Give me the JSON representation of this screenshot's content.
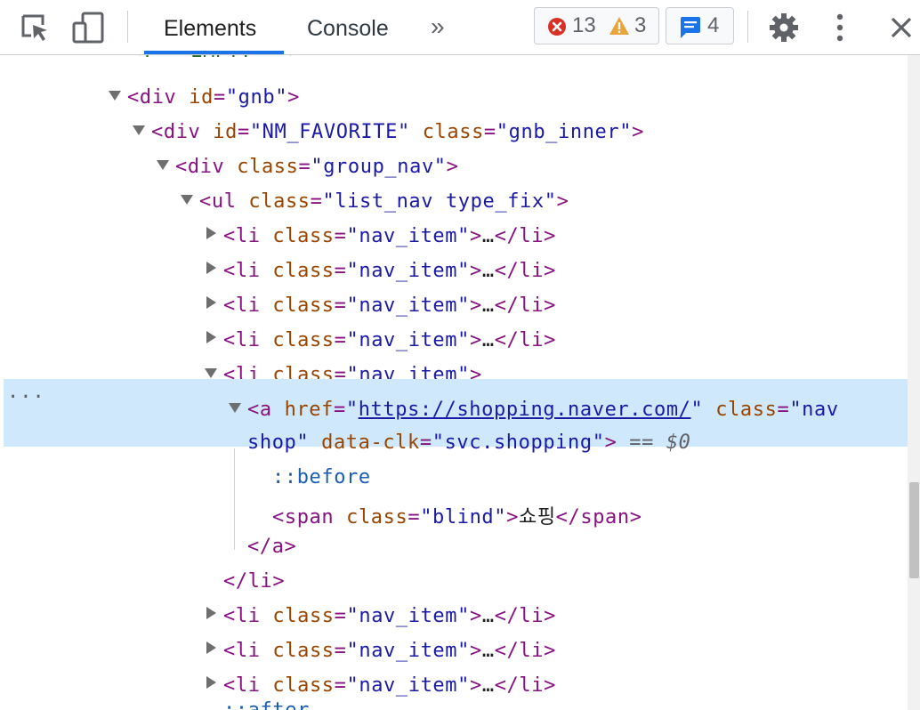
{
  "toolbar": {
    "tabs": [
      {
        "label": "Elements"
      },
      {
        "label": "Console"
      }
    ],
    "more_tabs_glyph": "»",
    "errors": "13",
    "warnings": "3",
    "messages": "4",
    "icons": {
      "inspect": "inspect-element-icon",
      "device": "device-toolbar-icon",
      "error": "error-icon",
      "warning": "warning-icon",
      "message": "message-icon",
      "settings": "gear-icon",
      "menu": "kebab-menu-icon",
      "close": "close-icon"
    },
    "colors": {
      "accent": "#1a73e8",
      "error": "#d93025",
      "warning": "#e37400",
      "message": "#1a73e8"
    }
  },
  "tree": {
    "comment_partial": "<!-- EMPTY -->",
    "nodes": [
      {
        "tag": "div",
        "attrs": [
          {
            "n": "id",
            "v": "\"gnb\""
          }
        ]
      },
      {
        "tag": "div",
        "attrs": [
          {
            "n": "id",
            "v": "\"NM_FAVORITE\""
          },
          {
            "n": "class",
            "v": "\"gnb_inner\""
          }
        ]
      },
      {
        "tag": "div",
        "attrs": [
          {
            "n": "class",
            "v": "\"group_nav\""
          }
        ]
      },
      {
        "tag": "ul",
        "attrs": [
          {
            "n": "class",
            "v": "\"list_nav type_fix\""
          }
        ]
      }
    ],
    "collapsed_item": {
      "tag": "li",
      "attr_name": "class",
      "attr_value": "\"nav_item\"",
      "ellipsis": "…",
      "close": "</li>"
    },
    "open_item": {
      "tag": "li",
      "attr_name": "class",
      "attr_value": "\"nav_item\""
    },
    "selected": {
      "tag": "a",
      "href_name": "href",
      "href_value": "https://shopping.naver.com/",
      "class_name": "class",
      "class_value_1": "\"nav",
      "class_value_2": "shop\"",
      "clk_name": "data-clk",
      "clk_value": "\"svc.shopping\"",
      "eq": "== $0",
      "dots": "..."
    },
    "before": "::before",
    "span": {
      "tag": "span",
      "attr_name": "class",
      "attr_value": "\"blind\"",
      "text": "쇼핑",
      "close": "</span>"
    },
    "a_close": "</a>",
    "li_close": "</li>",
    "after": "::after"
  }
}
